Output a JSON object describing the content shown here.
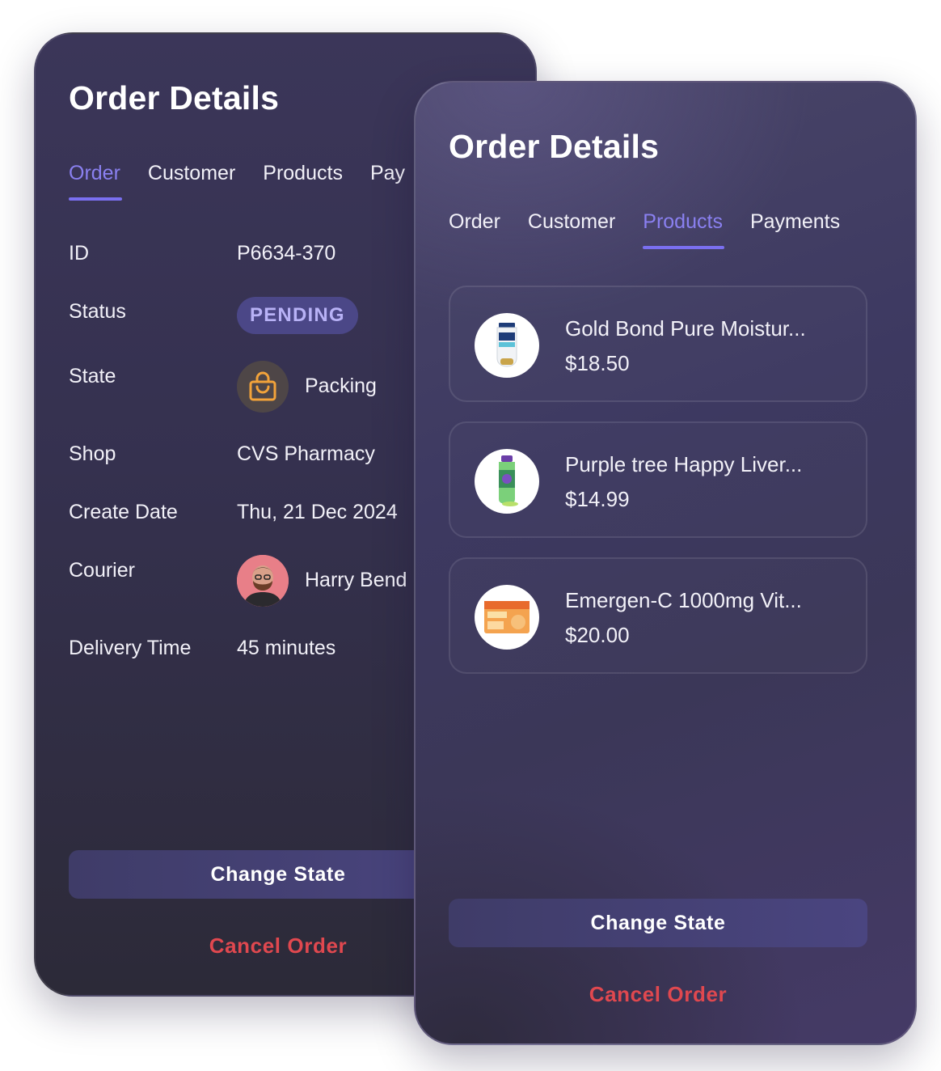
{
  "back_card": {
    "title": "Order Details",
    "tabs": [
      {
        "label": "Order",
        "active": true
      },
      {
        "label": "Customer",
        "active": false
      },
      {
        "label": "Products",
        "active": false
      },
      {
        "label": "Pay",
        "active": false
      }
    ],
    "fields": {
      "id_label": "ID",
      "id_value": "P6634-370",
      "status_label": "Status",
      "status_value": "PENDING",
      "state_label": "State",
      "state_icon": "shopping-bag-icon",
      "state_value": "Packing",
      "shop_label": "Shop",
      "shop_value": "CVS Pharmacy",
      "create_date_label": "Create Date",
      "create_date_value": "Thu, 21 Dec 2024",
      "courier_label": "Courier",
      "courier_value": "Harry Bend",
      "delivery_time_label": "Delivery Time",
      "delivery_time_value": "45 minutes"
    },
    "change_state_label": "Change State",
    "cancel_order_label": "Cancel Order"
  },
  "front_card": {
    "title": "Order Details",
    "tabs": [
      {
        "label": "Order",
        "active": false
      },
      {
        "label": "Customer",
        "active": false
      },
      {
        "label": "Products",
        "active": true
      },
      {
        "label": "Payments",
        "active": false
      }
    ],
    "products": [
      {
        "name": "Gold Bond Pure Moistur...",
        "price": "$18.50",
        "image": "lotion-tube"
      },
      {
        "name": "Purple tree Happy Liver...",
        "price": "$14.99",
        "image": "supplement-bottle"
      },
      {
        "name": "Emergen-C 1000mg Vit...",
        "price": "$20.00",
        "image": "vitamin-box"
      }
    ],
    "change_state_label": "Change State",
    "cancel_order_label": "Cancel Order"
  },
  "colors": {
    "accent": "#8a80f0",
    "danger": "#e0484f",
    "badge_bg": "#4b4787",
    "state_icon": "#f2a33a"
  }
}
